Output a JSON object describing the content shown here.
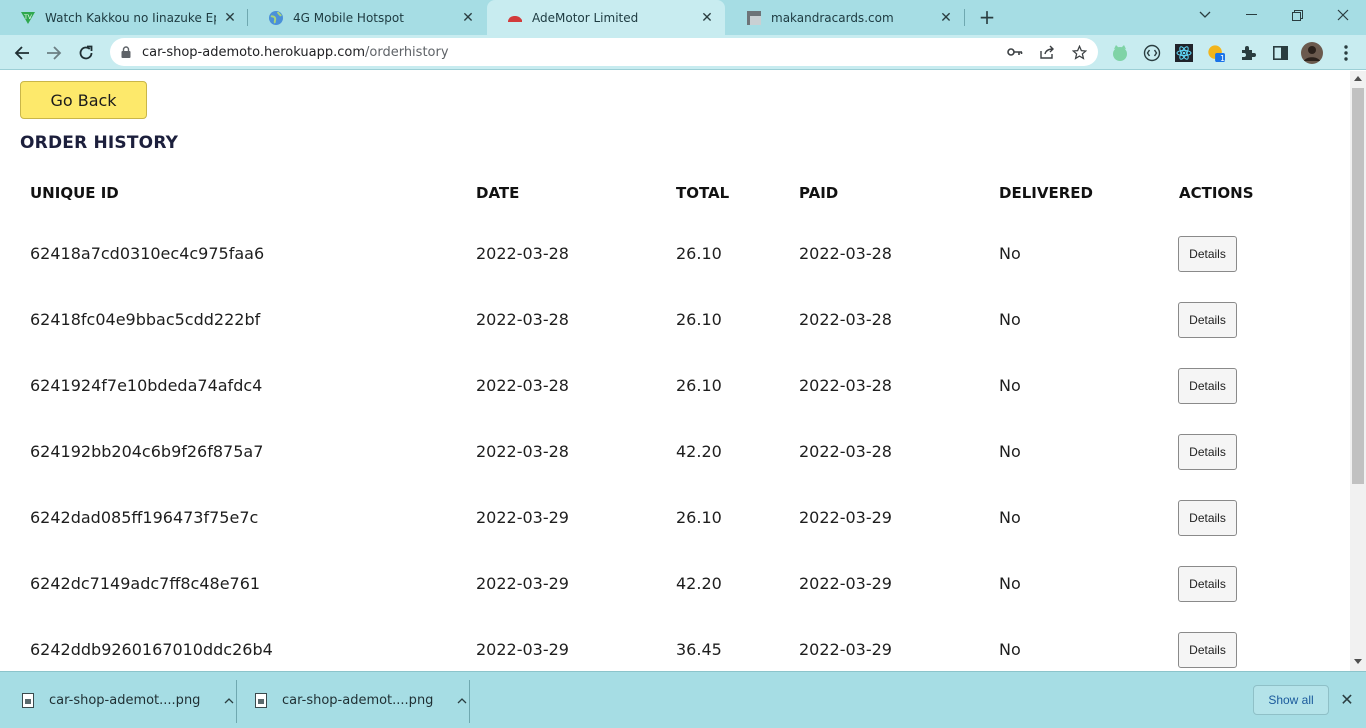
{
  "browser": {
    "tabs": [
      {
        "title": "Watch Kakkou no Iinazuke Episo",
        "icon": "tv-favicon",
        "active": false
      },
      {
        "title": "4G Mobile Hotspot",
        "icon": "globe-favicon",
        "active": false
      },
      {
        "title": "AdeMotor Limited",
        "icon": "car-favicon",
        "active": true
      },
      {
        "title": "makandracards.com",
        "icon": "page-favicon",
        "active": false
      }
    ],
    "url_host": "car-shop-ademoto.herokuapp.com",
    "url_path": "/orderhistory",
    "extension_badge": "1"
  },
  "page": {
    "go_back_label": "Go Back",
    "heading": "ORDER HISTORY",
    "columns": [
      "UNIQUE ID",
      "DATE",
      "TOTAL",
      "PAID",
      "DELIVERED",
      "ACTIONS"
    ],
    "orders": [
      {
        "id": "62418a7cd0310ec4c975faa6",
        "date": "2022-03-28",
        "total": "26.10",
        "paid": "2022-03-28",
        "delivered": "No",
        "action": "Details"
      },
      {
        "id": "62418fc04e9bbac5cdd222bf",
        "date": "2022-03-28",
        "total": "26.10",
        "paid": "2022-03-28",
        "delivered": "No",
        "action": "Details"
      },
      {
        "id": "6241924f7e10bdeda74afdc4",
        "date": "2022-03-28",
        "total": "26.10",
        "paid": "2022-03-28",
        "delivered": "No",
        "action": "Details"
      },
      {
        "id": "624192bb204c6b9f26f875a7",
        "date": "2022-03-28",
        "total": "42.20",
        "paid": "2022-03-28",
        "delivered": "No",
        "action": "Details"
      },
      {
        "id": "6242dad085ff196473f75e7c",
        "date": "2022-03-29",
        "total": "26.10",
        "paid": "2022-03-29",
        "delivered": "No",
        "action": "Details"
      },
      {
        "id": "6242dc7149adc7ff8c48e761",
        "date": "2022-03-29",
        "total": "42.20",
        "paid": "2022-03-29",
        "delivered": "No",
        "action": "Details"
      },
      {
        "id": "6242ddb9260167010ddc26b4",
        "date": "2022-03-29",
        "total": "36.45",
        "paid": "2022-03-29",
        "delivered": "No",
        "action": "Details"
      }
    ]
  },
  "downloads": {
    "items": [
      {
        "name": "car-shop-ademot....png"
      },
      {
        "name": "car-shop-ademot....png"
      }
    ],
    "show_all_label": "Show all"
  },
  "colors": {
    "chrome_frame": "#a6dde4",
    "toolbar": "#c8ecf0",
    "go_back_button": "#fde96b",
    "heading_text": "#1c1f3c"
  }
}
